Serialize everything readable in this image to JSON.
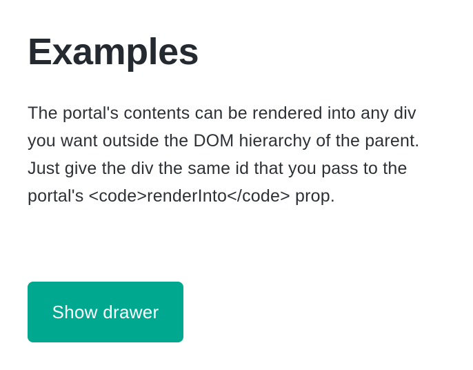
{
  "page": {
    "title": "Examples",
    "description": "The portal's contents can be rendered into any div you want outside the DOM hierarchy of the parent. Just give the div the same id that you pass to the portal's <code>renderInto</code> prop."
  },
  "actions": {
    "show_drawer_label": "Show drawer"
  },
  "colors": {
    "button_background": "#00a88f",
    "button_text": "#ffffff",
    "text": "#24292f"
  }
}
